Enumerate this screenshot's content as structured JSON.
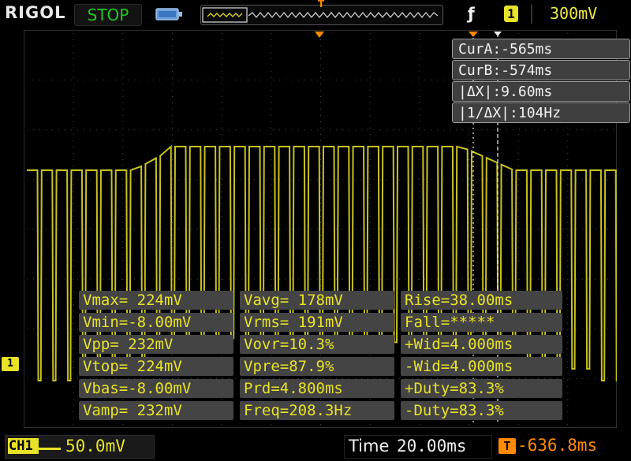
{
  "header": {
    "brand": "RIGOL",
    "run_state": "STOP",
    "trigger_channel": "1",
    "trigger_level": "300mV",
    "trigger_edge_icon": "rising-edge-icon",
    "battery_icon": "battery-icon"
  },
  "cursors": {
    "cur_a": "CurA:-565ms",
    "cur_b": "CurB:-574ms",
    "delta_x": "|ΔX|:9.60ms",
    "inv_delta_x": "|1/ΔX|:104Hz"
  },
  "measurements": [
    [
      "Vmax= 224mV",
      "Vavg= 178mV",
      "Rise=38.00ms"
    ],
    [
      "Vmin=-8.00mV",
      "Vrms= 191mV",
      "Fall=*****"
    ],
    [
      "Vpp= 232mV",
      "Vovr=10.3%",
      "+Wid=4.000ms"
    ],
    [
      "Vtop= 224mV",
      "Vpre=87.9%",
      "-Wid=4.000ms"
    ],
    [
      "Vbas=-8.00mV",
      "Prd=4.800ms",
      "+Duty=83.3%"
    ],
    [
      "Vamp= 232mV",
      "Freq=208.3Hz",
      "-Duty=83.3%"
    ]
  ],
  "channel": {
    "marker": "1",
    "label": "CH1",
    "scale": "50.0mV",
    "color": "#e8e228"
  },
  "timebase": {
    "label": "Time",
    "value": "20.00ms",
    "offset": "-636.8ms",
    "offset_icon": "T"
  },
  "colors": {
    "trace": "#c8c21e",
    "grid": "#4a4a4a",
    "cursor": "#f0f0f0",
    "trigger": "#ff8a00",
    "run_state": "#22c722"
  }
}
